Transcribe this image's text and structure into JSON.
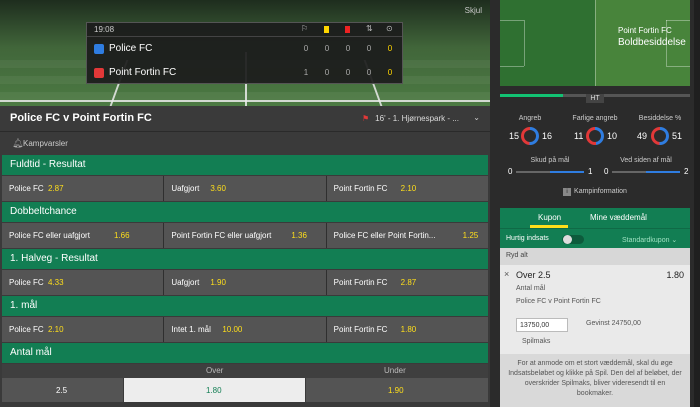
{
  "scoreboard": {
    "time": "19:08",
    "hide_label": "Skjul",
    "icons": [
      "corner-icon",
      "yellow-card-icon",
      "red-card-icon",
      "substitution-icon",
      "penalty-icon"
    ],
    "teams": [
      {
        "name": "Police FC",
        "stats": [
          "0",
          "0",
          "0",
          "0"
        ],
        "score": "0"
      },
      {
        "name": "Point Fortin FC",
        "stats": [
          "1",
          "0",
          "0",
          "0"
        ],
        "score": "0"
      }
    ]
  },
  "match": {
    "title": "Police FC v Point Fortin FC",
    "last_event": "16' - 1. Hjørnespark - ...",
    "alerts_label": "Kampvarsler"
  },
  "markets": [
    {
      "title": "Fuldtid - Resultat",
      "outcomes": [
        {
          "name": "Police FC",
          "odds": "2.87"
        },
        {
          "name": "Uafgjort",
          "odds": "3.60"
        },
        {
          "name": "Point Fortin FC",
          "odds": "2.10"
        }
      ]
    },
    {
      "title": "Dobbeltchance",
      "outcomes": [
        {
          "name": "Police FC eller uafgjort",
          "odds": "1.66"
        },
        {
          "name": "Point Fortin FC eller uafgjort",
          "odds": "1.36"
        },
        {
          "name": "Police FC eller Point Fortin...",
          "odds": "1.25"
        }
      ]
    },
    {
      "title": "1. Halveg - Resultat",
      "outcomes": [
        {
          "name": "Police FC",
          "odds": "4.33"
        },
        {
          "name": "Uafgjort",
          "odds": "1.90"
        },
        {
          "name": "Point Fortin FC",
          "odds": "2.87"
        }
      ]
    },
    {
      "title": "1. mål",
      "outcomes": [
        {
          "name": "Police FC",
          "odds": "2.10"
        },
        {
          "name": "Intet 1. mål",
          "odds": "10.00"
        },
        {
          "name": "Point Fortin FC",
          "odds": "1.80"
        }
      ]
    }
  ],
  "goals_market": {
    "title": "Antal mål",
    "over_label": "Over",
    "under_label": "Under",
    "line": "2.5",
    "over_odds": "1.80",
    "under_odds": "1.90"
  },
  "sidebar": {
    "possession_team": "Point Fortin FC",
    "possession_state": "Boldbesiddelse",
    "period_label": "HT",
    "period_progress": 0.33,
    "stats": [
      {
        "label": "Angreb",
        "home": "15",
        "away": "16"
      },
      {
        "label": "Farlige angreb",
        "home": "11",
        "away": "10"
      },
      {
        "label": "Besiddelse %",
        "home": "49",
        "away": "51"
      }
    ],
    "shots": [
      {
        "label": "Skud på mål",
        "home": "0",
        "away": "1"
      },
      {
        "label": "Ved siden af mål",
        "home": "0",
        "away": "2"
      }
    ],
    "match_info": "Kampinformation",
    "colors": {
      "home": "#e23838",
      "away": "#2f7de1",
      "accent": "#127e53",
      "odds": "#ffdf1b"
    }
  },
  "betslip": {
    "tab_coupon": "Kupon",
    "tab_mybets": "Mine væddemål",
    "quick_bet": "Hurtig indsats",
    "standard": "Standardkupon ⌄",
    "clear_all": "Ryd alt",
    "selection": "Over 2.5",
    "odds": "1.80",
    "market": "Antal mål",
    "event": "Police FC v Point Fortin FC",
    "stake": "13750,00",
    "win": "Gevinst 24750,00",
    "max_stake": "Spilmaks",
    "note": "For at anmode om et stort væddemål, skal du øge Indsatsbeløbet og klikke på Spil. Den del af beløbet, der overskrider Spilmaks, bliver videresendt til en bookmaker."
  }
}
